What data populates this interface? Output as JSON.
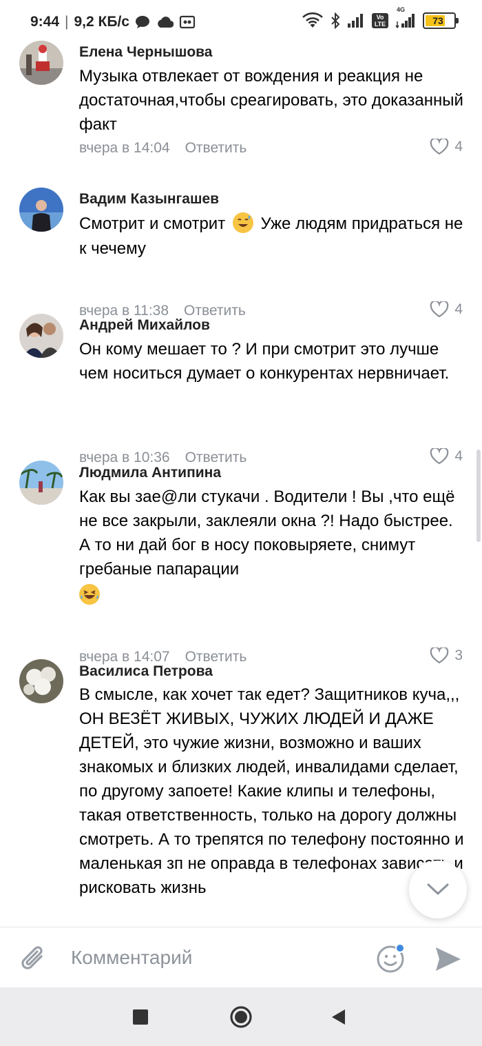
{
  "status_bar": {
    "time": "9:44",
    "speed": "9,2 КБ/с",
    "network_label": "4G",
    "volte_label": "Vo LTE",
    "battery": "73"
  },
  "comments": [
    {
      "author": "Елена Чернышова",
      "text": "Музыка отвлекает от вождения и реакция не достаточная,чтобы среагировать, это доказанный факт",
      "time": "вчера в 14:04",
      "reply": "Ответить",
      "likes": "4"
    },
    {
      "author": "Вадим Казынгашев",
      "text_a": "Смотрит и смотрит",
      "text_b": "Уже людям придраться не к чечему",
      "time": "вчера в 11:38",
      "reply": "Ответить",
      "likes": "4"
    },
    {
      "author": "Андрей Михайлов",
      "text": "Он кому мешает то ? И при смотрит  это лучше  чем носиться думает о конкурентах нервничает.",
      "time": "вчера в 10:36",
      "reply": "Ответить",
      "likes": "4"
    },
    {
      "author": "Людмила Антипина",
      "text": "Как вы зае@ли стукачи . Водители ! Вы ,что ещё не все закрыли, заклеяли окна ?! Надо быстрее. А то ни дай бог в носу поковыряете, снимут гребаные папарации",
      "time": "вчера в 14:07",
      "reply": "Ответить",
      "likes": "3"
    },
    {
      "author": "Василиса Петрова",
      "text": "В смысле, как хочет так едет? Защитников куча,,, ОН ВЕЗЁТ ЖИВЫХ, ЧУЖИХ ЛЮДЕЙ И ДАЖЕ ДЕТЕЙ, это чужие жизни, возможно и ваших знакомых и близких людей, инвалидами сделает, по другому запоете! Какие клипы и телефоны, такая ответственность, только на дорогу должны смотреть. А то трепятся по телефону постоянно и маленькая зп не оправда в телефонах зависать и рисковать жизнь"
    }
  ],
  "comment_input": {
    "placeholder": "Комментарий"
  },
  "colors": {
    "meta_gray": "#8a8f96",
    "emoji_yellow": "#f7c443",
    "battery_yellow": "#f5c21a",
    "input_icon_gray": "#9aa0a8"
  }
}
